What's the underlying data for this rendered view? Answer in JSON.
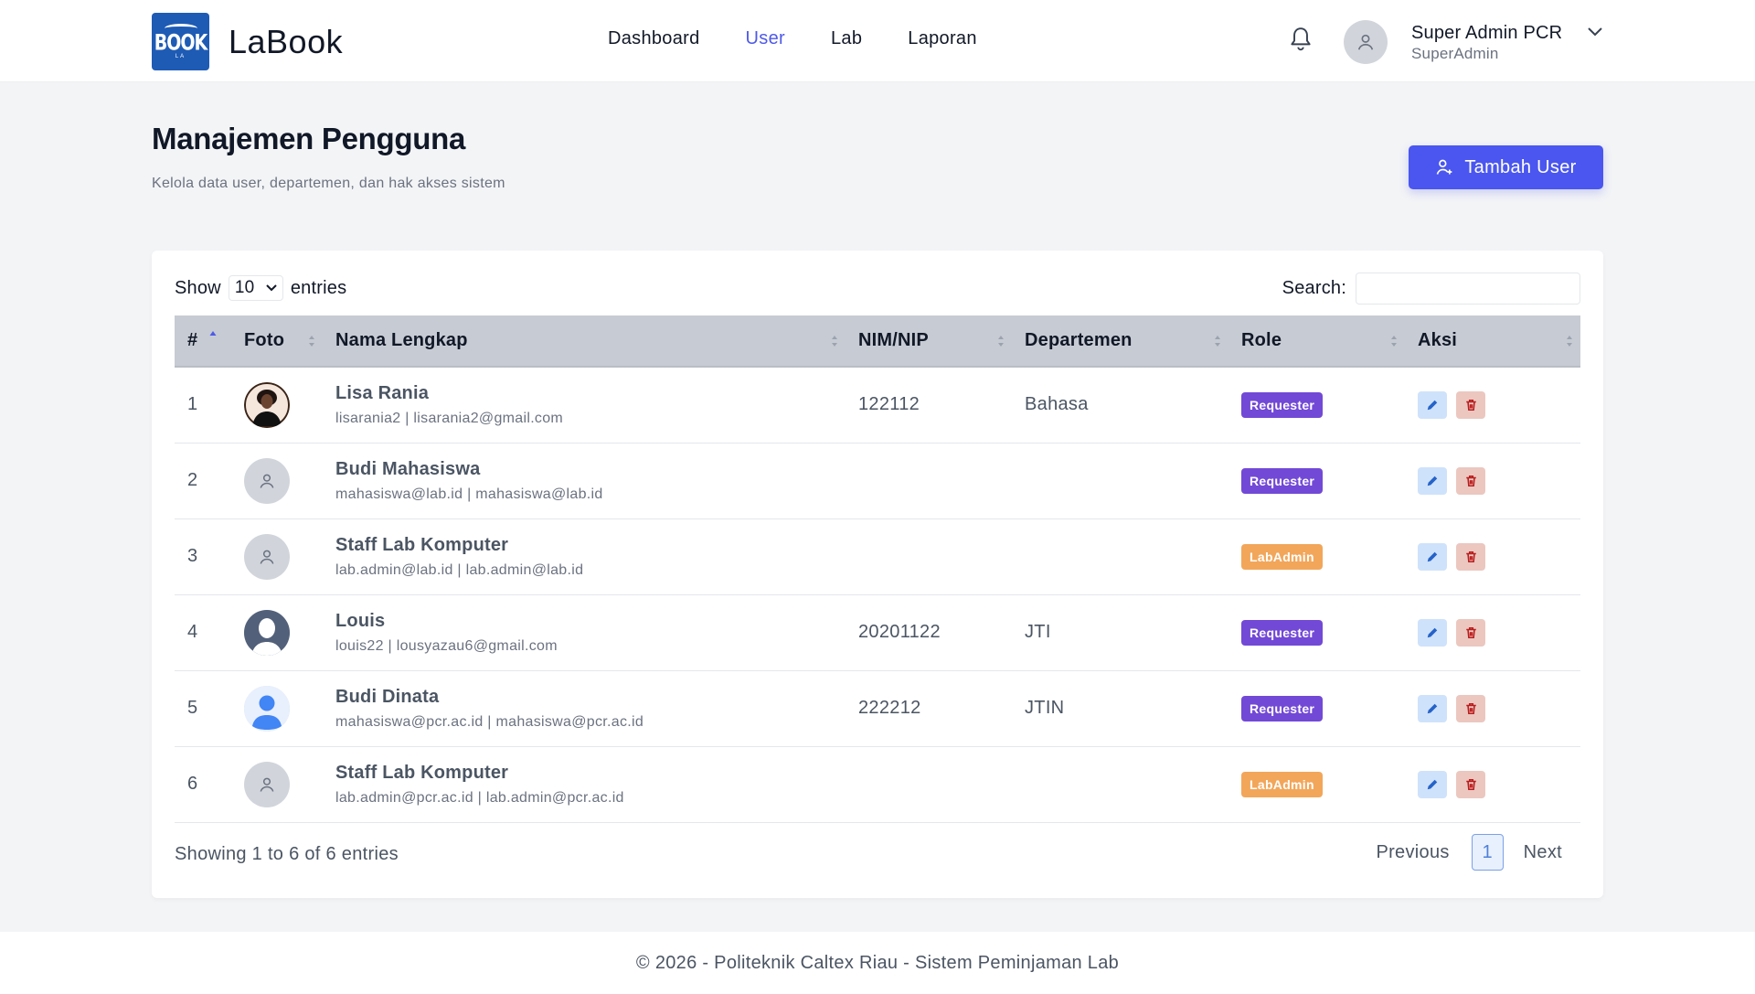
{
  "brand": {
    "name": "LaBook",
    "logo_text": "BOOK",
    "logo_sub": "LA"
  },
  "nav": {
    "items": [
      {
        "label": "Dashboard",
        "active": false
      },
      {
        "label": "User",
        "active": true
      },
      {
        "label": "Lab",
        "active": false
      },
      {
        "label": "Laporan",
        "active": false
      }
    ]
  },
  "user": {
    "name": "Super Admin PCR",
    "role": "SuperAdmin"
  },
  "header": {
    "title": "Manajemen Pengguna",
    "subtitle": "Kelola data user, departemen, dan hak akses sistem",
    "add_button": "Tambah User"
  },
  "table_controls": {
    "show_label": "Show",
    "entries_value": "10",
    "entries_label": "entries",
    "search_label": "Search:",
    "search_value": ""
  },
  "table": {
    "columns": [
      "#",
      "Foto",
      "Nama Lengkap",
      "NIM/NIP",
      "Departemen",
      "Role",
      "Aksi"
    ],
    "rows": [
      {
        "no": "1",
        "photo": "photo",
        "name": "Lisa Rania",
        "email": "lisarania2 | lisarania2@gmail.com",
        "nim": "122112",
        "dept": "Bahasa",
        "role": "Requester"
      },
      {
        "no": "2",
        "photo": "default",
        "name": "Budi Mahasiswa",
        "email": "mahasiswa@lab.id | mahasiswa@lab.id",
        "nim": "",
        "dept": "",
        "role": "Requester"
      },
      {
        "no": "3",
        "photo": "default",
        "name": "Staff Lab Komputer",
        "email": "lab.admin@lab.id | lab.admin@lab.id",
        "nim": "",
        "dept": "",
        "role": "LabAdmin"
      },
      {
        "no": "4",
        "photo": "silhouette",
        "name": "Louis",
        "email": "louis22 | lousyazau6@gmail.com",
        "nim": "20201122",
        "dept": "JTI",
        "role": "Requester"
      },
      {
        "no": "5",
        "photo": "blue-person",
        "name": "Budi Dinata",
        "email": "mahasiswa@pcr.ac.id | mahasiswa@pcr.ac.id",
        "nim": "222212",
        "dept": "JTIN",
        "role": "Requester"
      },
      {
        "no": "6",
        "photo": "default",
        "name": "Staff Lab Komputer",
        "email": "lab.admin@pcr.ac.id | lab.admin@pcr.ac.id",
        "nim": "",
        "dept": "",
        "role": "LabAdmin"
      }
    ]
  },
  "pagination": {
    "info": "Showing 1 to 6 of 6 entries",
    "previous": "Previous",
    "current": "1",
    "next": "Next"
  },
  "footer": {
    "text": "© 2026 - Politeknik Caltex Riau - Sistem Peminjaman Lab"
  },
  "colors": {
    "accent": "#4a56ef",
    "requester": "#7249d6",
    "labadmin": "#f2a65a",
    "nav_active": "#4f5ae8"
  }
}
